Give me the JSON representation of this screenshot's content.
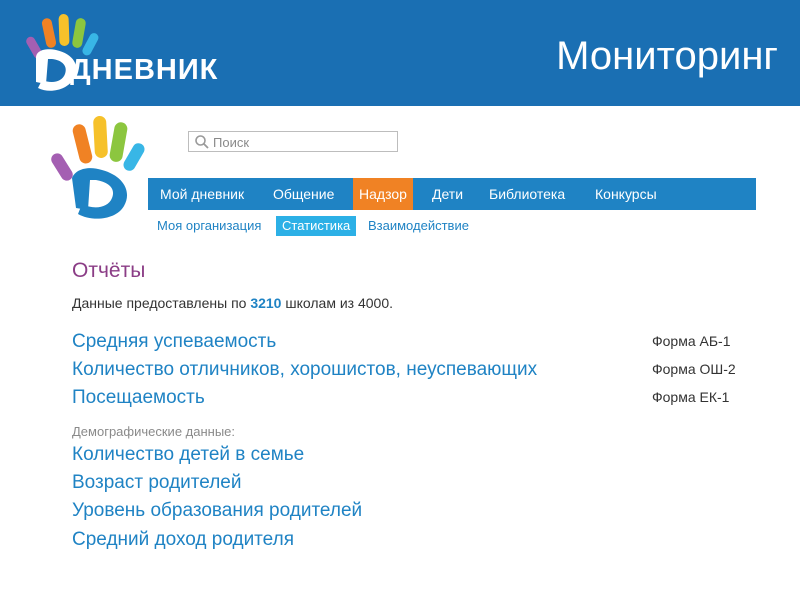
{
  "slide": {
    "title": "Мониторинг",
    "logo_text": "ДНЕВНИК"
  },
  "colors": {
    "banner": "#1a6fb3",
    "nav": "#1f83c4",
    "nav_active": "#f08224",
    "subnav_active": "#2cb0e6",
    "heading": "#8b3d86",
    "link": "#1f83c4"
  },
  "search": {
    "placeholder": "Поиск",
    "icon": "search-icon"
  },
  "nav": {
    "items": [
      "Мой дневник",
      "Общение",
      "Надзор",
      "Дети",
      "Библиотека",
      "Конкурсы"
    ],
    "active": "Надзор"
  },
  "subnav": {
    "items": [
      "Моя организация",
      "Статистика",
      "Взаимодействие"
    ],
    "active": "Статистика"
  },
  "reports": {
    "title": "Отчёты",
    "info_prefix": "Данные предоставлены по",
    "schools_count": "3210",
    "info_suffix": "школам из 4000.",
    "links": [
      {
        "label": "Средняя успеваемость",
        "form": "Форма АБ-1"
      },
      {
        "label": "Количество отличников, хорошистов, неуспевающих",
        "form": "Форма ОШ-2"
      },
      {
        "label": "Посещаемость",
        "form": "Форма ЕК-1"
      }
    ],
    "demographics_label": "Демографические данные:",
    "demographics": [
      "Количество детей в семье",
      "Возраст родителей",
      "Уровень образования родителей",
      "Средний доход родителя"
    ]
  }
}
